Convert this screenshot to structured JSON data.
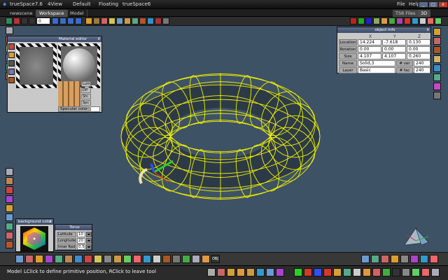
{
  "app": {
    "title": "trueSpace7.6"
  },
  "titlebar": {
    "menus": [
      "4View",
      "Default",
      "Floating",
      "trueSpace6"
    ],
    "file_label": "File",
    "help_label": "Help",
    "min_label": "_",
    "max_label": "□",
    "close_label": "x"
  },
  "tabs": [
    "newscene",
    "Workspace",
    "Model"
  ],
  "right_tabs": {
    "files": "TS6 Files",
    "view3d": "3D"
  },
  "spinner_value": "0",
  "material_editor": {
    "title": "Material editor",
    "channels": [
      "Lum",
      "Dif",
      "Shi",
      "Spc"
    ],
    "specular_label": "Specular color"
  },
  "object_info": {
    "title": "object info",
    "columns": [
      "X",
      "Y",
      "Z"
    ],
    "rows": [
      {
        "label": "Location",
        "values": [
          "14.224",
          "-7.618",
          "0.130"
        ]
      },
      {
        "label": "Rotation",
        "values": [
          "0.00",
          "0.00",
          "0.00"
        ]
      },
      {
        "label": "Size",
        "values": [
          "4.107",
          "4.107",
          "0.260"
        ]
      }
    ],
    "name_label": "Name",
    "name_value": "Solid,3",
    "vert_label": "# ver",
    "vert_value": "240",
    "layer_label": "Layer",
    "layer_value": "Basic",
    "face_label": "# fac",
    "face_value": "240"
  },
  "background_color": {
    "title": "background color"
  },
  "torus": {
    "title": "Torus",
    "rows": [
      {
        "label": "Latitude",
        "value": "10"
      },
      {
        "label": "Longitude",
        "value": "20"
      },
      {
        "label": "Inner Rad",
        "value": "0.5"
      }
    ]
  },
  "status": {
    "mode": "Model",
    "message": "LClick to define primitive position, RClick to leave tool"
  },
  "colors": {
    "viewport": "#3e5266",
    "wireframe": "#f2f200",
    "mesh_fill": "#2c3a48",
    "panel": "#c9c9c9",
    "panel_header": "#4a5a78"
  }
}
